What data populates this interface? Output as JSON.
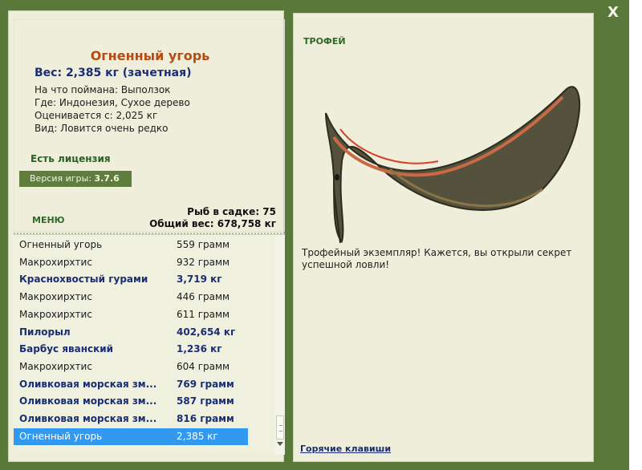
{
  "window": {
    "close_label": "X"
  },
  "fish": {
    "title": "Огненный угорь",
    "weight_line": "Вес: 2,385 кг (зачетная)",
    "caught_on": "На что поймана: Выползок",
    "where": "Где: Индонезия, Сухое дерево",
    "valued_from": "Оценивается с: 2,025 кг",
    "kind": "Вид: Ловится очень редко"
  },
  "license": "Есть лицензия",
  "version": {
    "label": "Версия игры:",
    "value": "3.7.6"
  },
  "menu_label": "МЕНЮ",
  "stats": {
    "fish_in_cage": "Рыб в садке: 75",
    "total_weight": "Общий вес: 678,758 кг"
  },
  "catch_list": [
    {
      "name": "Огненный угорь",
      "weight": "559 грамм",
      "bold": false
    },
    {
      "name": "Макрохирхтис",
      "weight": "932 грамм",
      "bold": false
    },
    {
      "name": "Краснохвостый гурами",
      "weight": "3,719 кг",
      "bold": true
    },
    {
      "name": "Макрохирхтис",
      "weight": "446 грамм",
      "bold": false
    },
    {
      "name": "Макрохирхтис",
      "weight": "611 грамм",
      "bold": false
    },
    {
      "name": "Пилорыл",
      "weight": "402,654 кг",
      "bold": true
    },
    {
      "name": "Барбус яванский",
      "weight": "1,236 кг",
      "bold": true
    },
    {
      "name": "Макрохирхтис",
      "weight": "604 грамм",
      "bold": false
    },
    {
      "name": "Оливковая морская зм...",
      "weight": "769 грамм",
      "bold": true
    },
    {
      "name": "Оливковая морская зм...",
      "weight": "587 грамм",
      "bold": true
    },
    {
      "name": "Оливковая морская зм...",
      "weight": "816 грамм",
      "bold": true
    },
    {
      "name": "Огненный угорь",
      "weight": "2,385 кг",
      "bold": false,
      "selected": true
    }
  ],
  "trophy": {
    "label": "ТРОФЕЙ",
    "description": "Трофейный экземпляр! Кажется, вы открыли секрет успешной ловли!"
  },
  "hotkeys_label": "Горячие клавиши",
  "colors": {
    "frame": "#58793a",
    "panel": "#eeeedb",
    "title": "#b34d13",
    "navy": "#1b2d74",
    "selection": "#3399ee"
  }
}
